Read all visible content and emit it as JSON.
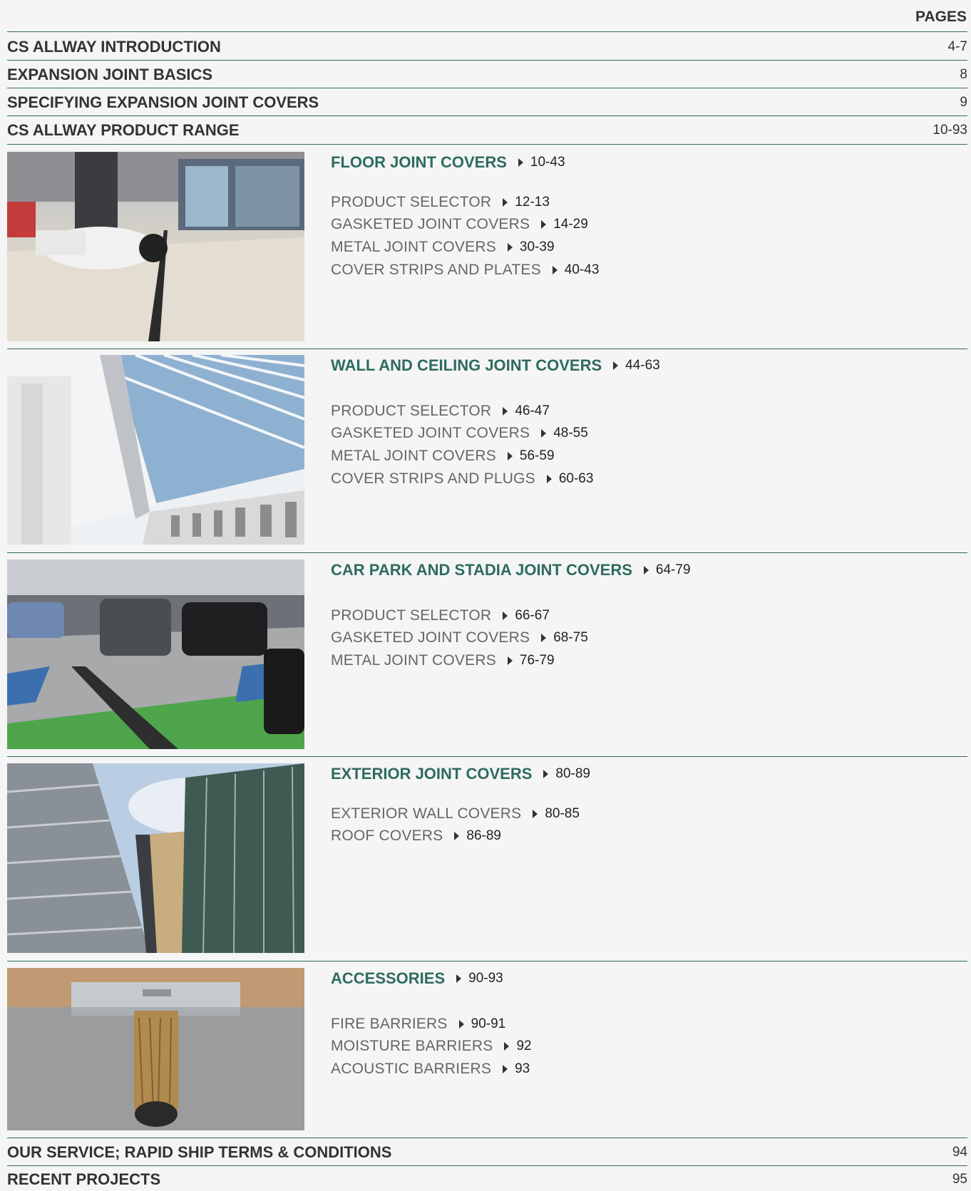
{
  "header": {
    "pages_label": "PAGES"
  },
  "toc_top": [
    {
      "title": "CS ALLWAY INTRODUCTION",
      "pages": "4-7"
    },
    {
      "title": "EXPANSION JOINT BASICS",
      "pages": "8"
    },
    {
      "title": "SPECIFYING EXPANSION JOINT COVERS",
      "pages": "9"
    },
    {
      "title": "CS ALLWAY PRODUCT RANGE",
      "pages": "10-93"
    }
  ],
  "sections": [
    {
      "title": "FLOOR JOINT COVERS",
      "pages": "10-43",
      "items": [
        {
          "title": "PRODUCT SELECTOR",
          "pages": "12-13"
        },
        {
          "title": "GASKETED JOINT COVERS",
          "pages": "14-29"
        },
        {
          "title": "METAL JOINT COVERS",
          "pages": "30-39"
        },
        {
          "title": "COVER STRIPS AND PLATES",
          "pages": "40-43"
        }
      ]
    },
    {
      "title": "WALL AND CEILING JOINT COVERS",
      "pages": "44-63",
      "items": [
        {
          "title": "PRODUCT SELECTOR",
          "pages": "46-47"
        },
        {
          "title": "GASKETED JOINT COVERS",
          "pages": "48-55"
        },
        {
          "title": "METAL JOINT COVERS",
          "pages": "56-59"
        },
        {
          "title": "COVER STRIPS AND PLUGS",
          "pages": "60-63"
        }
      ]
    },
    {
      "title": "CAR PARK AND STADIA JOINT COVERS",
      "pages": "64-79",
      "items": [
        {
          "title": "PRODUCT SELECTOR",
          "pages": "66-67"
        },
        {
          "title": "GASKETED JOINT COVERS",
          "pages": "68-75"
        },
        {
          "title": "METAL JOINT COVERS",
          "pages": "76-79"
        }
      ]
    },
    {
      "title": "EXTERIOR JOINT COVERS",
      "pages": "80-89",
      "items": [
        {
          "title": "EXTERIOR WALL COVERS",
          "pages": "80-85"
        },
        {
          "title": "ROOF COVERS",
          "pages": "86-89"
        }
      ]
    },
    {
      "title": "ACCESSORIES",
      "pages": "90-93",
      "items": [
        {
          "title": "FIRE BARRIERS",
          "pages": "90-91"
        },
        {
          "title": "MOISTURE BARRIERS",
          "pages": "92"
        },
        {
          "title": "ACOUSTIC BARRIERS",
          "pages": "93"
        }
      ]
    }
  ],
  "toc_bottom": [
    {
      "title": "OUR SERVICE; RAPID SHIP TERMS & CONDITIONS",
      "pages": "94"
    },
    {
      "title": "RECENT PROJECTS",
      "pages": "95"
    }
  ],
  "colors": {
    "accent": "#2e6b60",
    "text": "#333333",
    "item_text": "#666666"
  }
}
